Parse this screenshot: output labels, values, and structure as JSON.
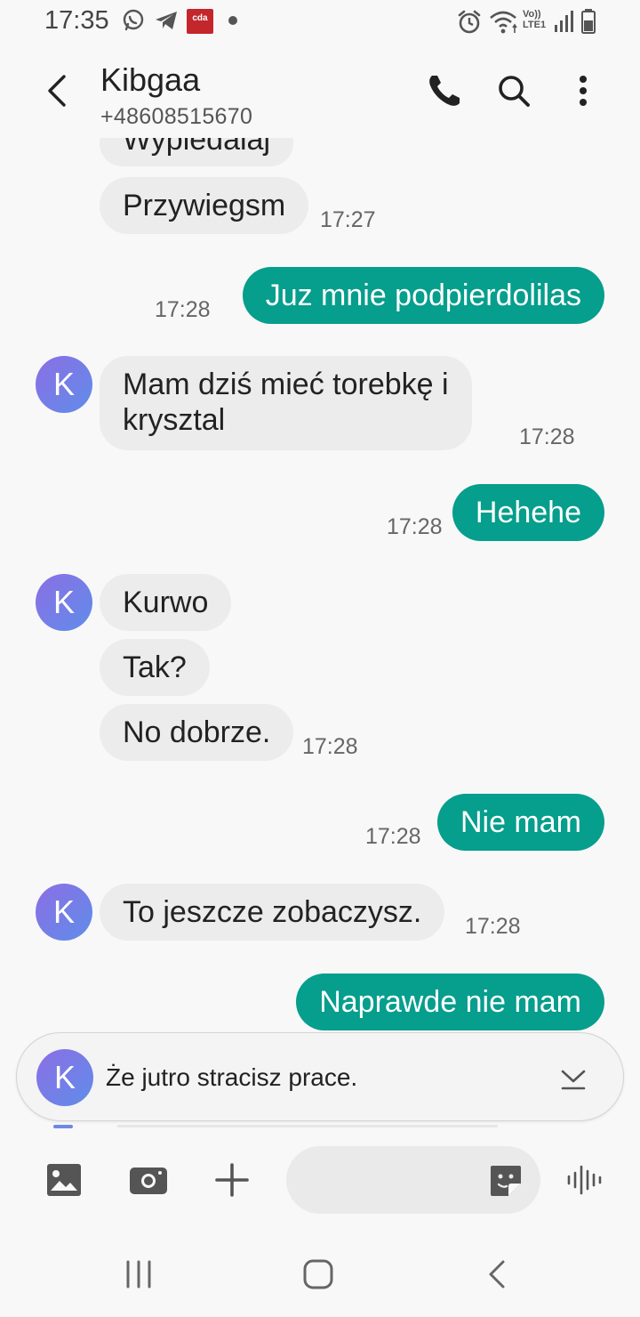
{
  "status_bar": {
    "time": "17:35",
    "notification_icons": [
      "whatsapp-icon",
      "telegram-icon",
      "cda-app-icon",
      "more-dot-icon"
    ],
    "system_icons": [
      "alarm-icon",
      "wifi-icon",
      "volte-lte-icon",
      "signal-icon",
      "battery-icon"
    ],
    "volte_label": "Vo)) LTE1",
    "cda_label": "cda"
  },
  "header": {
    "contact_name": "Kibgaa",
    "contact_number": "+48608515670",
    "icons": [
      "back-arrow-icon",
      "phone-icon",
      "search-icon",
      "more-vert-icon"
    ]
  },
  "messages": [
    {
      "direction": "in",
      "text": "Wypiedalaj",
      "time": "",
      "avatar": ""
    },
    {
      "direction": "in",
      "text": "Przywiegsm",
      "time": "17:27",
      "avatar": ""
    },
    {
      "direction": "out",
      "text": "Juz mnie podpierdolilas",
      "time": "17:28"
    },
    {
      "direction": "in",
      "lines": [
        "Mam dziś mieć torebkę i",
        "krysztal"
      ],
      "time": "17:28",
      "avatar": "K"
    },
    {
      "direction": "out",
      "text": "Hehehe",
      "time": "17:28"
    },
    {
      "direction": "in",
      "text": "Kurwo",
      "time": "",
      "avatar": "K"
    },
    {
      "direction": "in",
      "text": "Tak?",
      "time": ""
    },
    {
      "direction": "in",
      "text": "No dobrze.",
      "time": "17:28"
    },
    {
      "direction": "out",
      "text": "Nie mam",
      "time": "17:28"
    },
    {
      "direction": "in",
      "text": "To jeszcze zobaczysz.",
      "time": "17:28",
      "avatar": "K"
    },
    {
      "direction": "out",
      "text": "Naprawde nie mam",
      "time": ""
    }
  ],
  "preview": {
    "avatar": "K",
    "text": "Że jutro stracisz prace.",
    "icon": "chevron-down-icon"
  },
  "composer": {
    "placeholder": "",
    "icons": [
      "gallery-icon",
      "camera-icon",
      "add-icon",
      "sticker-icon",
      "voice-icon"
    ]
  },
  "nav_bar": {
    "icons": [
      "recents-icon",
      "home-icon",
      "back-icon"
    ]
  },
  "colors": {
    "outgoing_bubble": "#069e8c",
    "incoming_bubble": "#ececec",
    "avatar_gradient_start": "#8c6ee6",
    "avatar_gradient_end": "#5f8de8",
    "background": "#f8f8f8"
  }
}
